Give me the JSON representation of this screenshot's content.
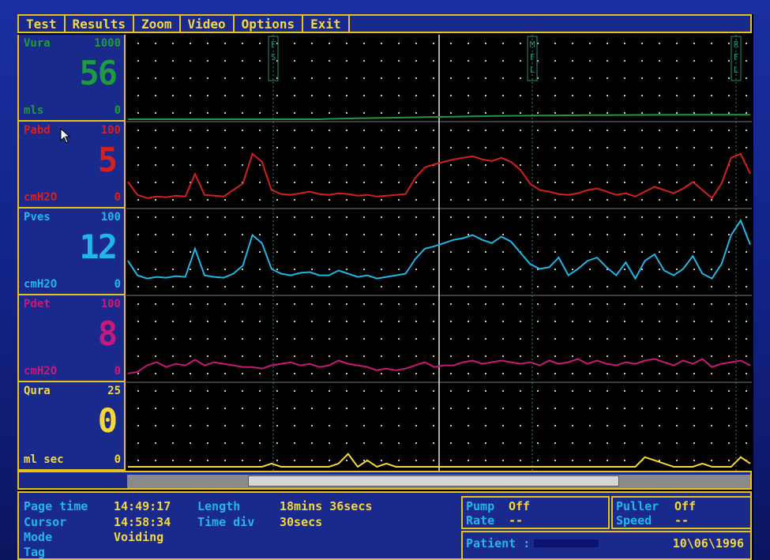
{
  "menu": [
    "Test",
    "Results",
    "Zoom",
    "Video",
    "Options",
    "Exit"
  ],
  "channels": [
    {
      "name": "Vura",
      "max": "1000",
      "value": "56",
      "unit": "mls",
      "min": "0",
      "color": "#1f9a3c"
    },
    {
      "name": "Pabd",
      "max": "100",
      "value": "5",
      "unit": "cmH2O",
      "min": "0",
      "color": "#d61f1f"
    },
    {
      "name": "Pves",
      "max": "100",
      "value": "12",
      "unit": "cmH2O",
      "min": "0",
      "color": "#1fb7e6"
    },
    {
      "name": "Pdet",
      "max": "100",
      "value": "8",
      "unit": "cmH2O",
      "min": "0",
      "color": "#c8197a"
    },
    {
      "name": "Qura",
      "max": "25",
      "value": "0",
      "unit": "ml sec",
      "min": "0",
      "color": "#f4d83a"
    }
  ],
  "markers": [
    "FS",
    "MFL",
    "RFL"
  ],
  "status": {
    "page_time_label": "Page time",
    "page_time": "14:49:17",
    "cursor_label": "Cursor",
    "cursor": "14:58:34",
    "mode_label": "Mode",
    "mode": "Voiding",
    "tag_label": "Tag",
    "length_label": "Length",
    "length": "18mins 36secs",
    "timediv_label": "Time div",
    "timediv": "30secs",
    "pump_label": "Pump",
    "pump": "Off",
    "rate_label": "Rate",
    "rate": "--",
    "puller_label": "Puller",
    "puller": "Off",
    "speed_label": "Speed",
    "speed": "--",
    "patient_label": "Patient :",
    "date": "10\\06\\1996"
  },
  "colors": {
    "panel": "#1a2a8c",
    "border": "#e6c21a",
    "vura": "#1f9a3c",
    "pabd": "#d61f1f",
    "pves": "#1fb7e6",
    "pdet": "#c8197a",
    "qura": "#f4d83a"
  },
  "chart_data": {
    "type": "line",
    "x": [
      0,
      12,
      24,
      36,
      48,
      60,
      72,
      84,
      96,
      108,
      120,
      132,
      144,
      156,
      168,
      180,
      192,
      204,
      216,
      228,
      240,
      252,
      264,
      276,
      288,
      300,
      312,
      324,
      336,
      348,
      360,
      372,
      384,
      396,
      408,
      420,
      432,
      444,
      456,
      468,
      480,
      492,
      504,
      516,
      528,
      540,
      552,
      564,
      576,
      588,
      600,
      612,
      624,
      636,
      648,
      660,
      672,
      684,
      696,
      708,
      720,
      732,
      744,
      756,
      768,
      780
    ],
    "series": [
      {
        "name": "Vura",
        "ylim": [
          0,
          1000
        ],
        "values": [
          0,
          0,
          0,
          0,
          0,
          0,
          0,
          0,
          0,
          0,
          0,
          0,
          0,
          0,
          0,
          0,
          0,
          0,
          0,
          0,
          0,
          5,
          8,
          10,
          12,
          14,
          16,
          18,
          20,
          22,
          24,
          26,
          28,
          30,
          32,
          34,
          36,
          38,
          40,
          42,
          43,
          44,
          45,
          46,
          47,
          48,
          49,
          50,
          51,
          52,
          52,
          53,
          53,
          54,
          54,
          55,
          55,
          55,
          56,
          56,
          56,
          56,
          56,
          56,
          56,
          56
        ]
      },
      {
        "name": "Pabd",
        "ylim": [
          0,
          100
        ],
        "values": [
          30,
          14,
          10,
          12,
          11,
          13,
          12,
          40,
          14,
          13,
          12,
          20,
          28,
          65,
          55,
          20,
          15,
          14,
          16,
          18,
          15,
          14,
          16,
          15,
          13,
          14,
          12,
          13,
          14,
          15,
          35,
          48,
          52,
          55,
          58,
          60,
          62,
          58,
          56,
          60,
          55,
          45,
          28,
          20,
          18,
          15,
          14,
          16,
          20,
          22,
          18,
          14,
          16,
          12,
          18,
          24,
          20,
          16,
          22,
          30,
          20,
          10,
          28,
          60,
          65,
          40
        ]
      },
      {
        "name": "Pves",
        "ylim": [
          0,
          100
        ],
        "values": [
          40,
          22,
          18,
          20,
          19,
          21,
          20,
          55,
          22,
          20,
          19,
          24,
          34,
          72,
          62,
          30,
          24,
          22,
          25,
          26,
          22,
          22,
          28,
          24,
          20,
          22,
          18,
          20,
          22,
          24,
          42,
          55,
          58,
          62,
          66,
          68,
          72,
          66,
          62,
          70,
          64,
          50,
          36,
          30,
          32,
          44,
          22,
          30,
          40,
          44,
          32,
          22,
          38,
          18,
          40,
          48,
          28,
          22,
          30,
          46,
          24,
          18,
          36,
          72,
          90,
          60
        ]
      },
      {
        "name": "Pdet",
        "ylim": [
          0,
          100
        ],
        "values": [
          8,
          10,
          18,
          22,
          16,
          20,
          18,
          25,
          18,
          22,
          20,
          18,
          16,
          16,
          14,
          18,
          20,
          22,
          18,
          20,
          16,
          18,
          24,
          20,
          18,
          16,
          12,
          14,
          12,
          14,
          18,
          22,
          16,
          18,
          18,
          22,
          24,
          20,
          22,
          24,
          22,
          20,
          22,
          18,
          24,
          20,
          22,
          26,
          20,
          24,
          20,
          18,
          22,
          20,
          24,
          26,
          22,
          18,
          24,
          20,
          26,
          16,
          20,
          22,
          24,
          18
        ]
      },
      {
        "name": "Qura",
        "ylim": [
          0,
          25
        ],
        "values": [
          0,
          0,
          0,
          0,
          0,
          0,
          0,
          0,
          0,
          0,
          0,
          0,
          0,
          0,
          0,
          1,
          0,
          0,
          0,
          0,
          0,
          0,
          1,
          4,
          0,
          2,
          0,
          1,
          0,
          0,
          0,
          0,
          0,
          0,
          0,
          0,
          0,
          0,
          0,
          0,
          0,
          0,
          0,
          0,
          0,
          0,
          0,
          0,
          0,
          0,
          0,
          0,
          0,
          0,
          3,
          2,
          1,
          0,
          0,
          0,
          1,
          0,
          0,
          0,
          3,
          1
        ]
      }
    ]
  }
}
